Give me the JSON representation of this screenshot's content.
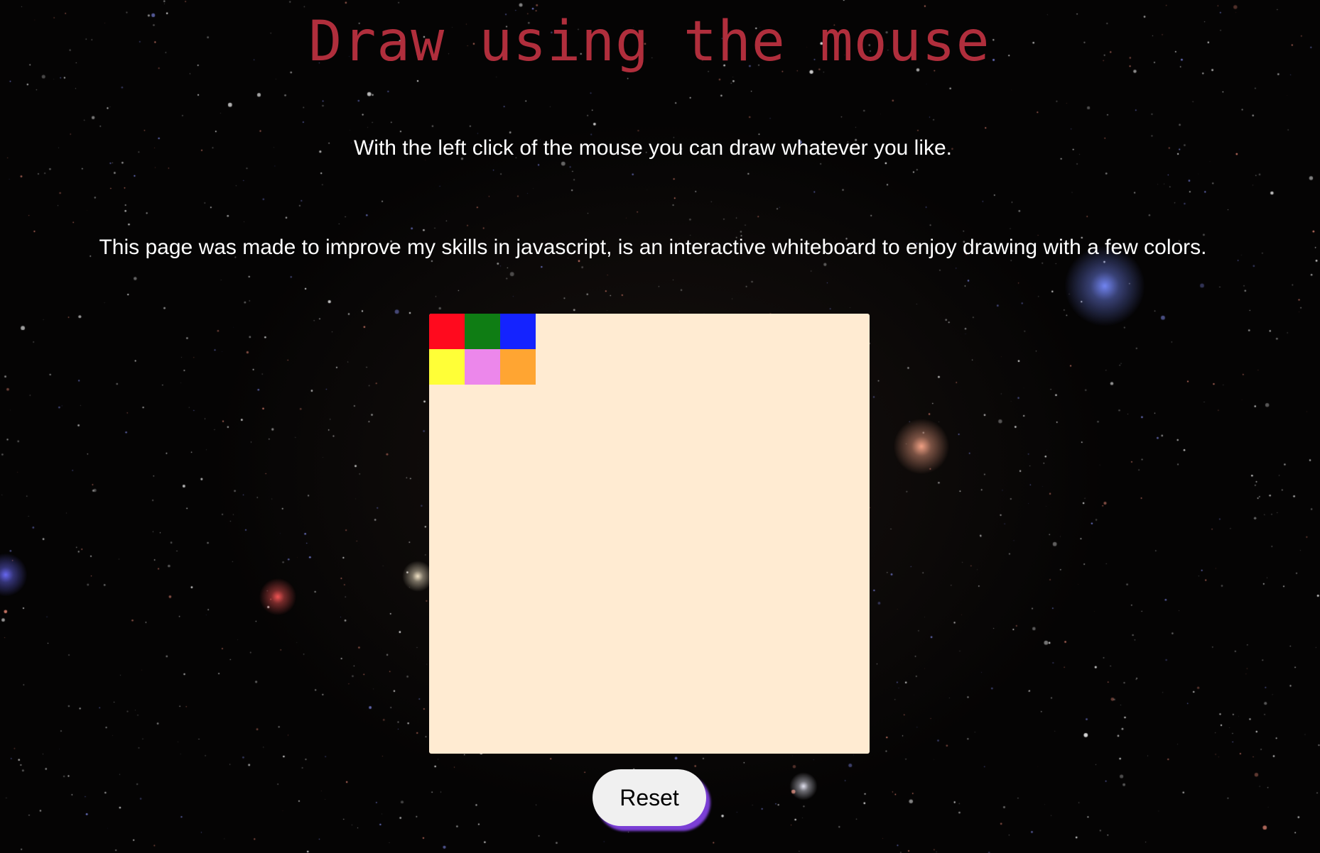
{
  "page": {
    "title": "Draw using the mouse",
    "instructions": "With the left click of the mouse you can draw whatever you like.",
    "description": "This page was made to improve my skills in javascript, is an interactive whiteboard to enjoy drawing with a few colors."
  },
  "whiteboard": {
    "background_color": "#ffebd2",
    "palette": [
      {
        "name": "red",
        "color": "#ff0a1e"
      },
      {
        "name": "green",
        "color": "#0f7d14"
      },
      {
        "name": "blue",
        "color": "#1423ff"
      },
      {
        "name": "yellow",
        "color": "#ffff37"
      },
      {
        "name": "violet",
        "color": "#ec87eb"
      },
      {
        "name": "orange",
        "color": "#ffa532"
      }
    ]
  },
  "controls": {
    "reset_label": "Reset",
    "reset_shadow_color": "#7b3fd6"
  },
  "theme": {
    "title_color": "#b02e3c",
    "text_color": "#ffffff"
  }
}
